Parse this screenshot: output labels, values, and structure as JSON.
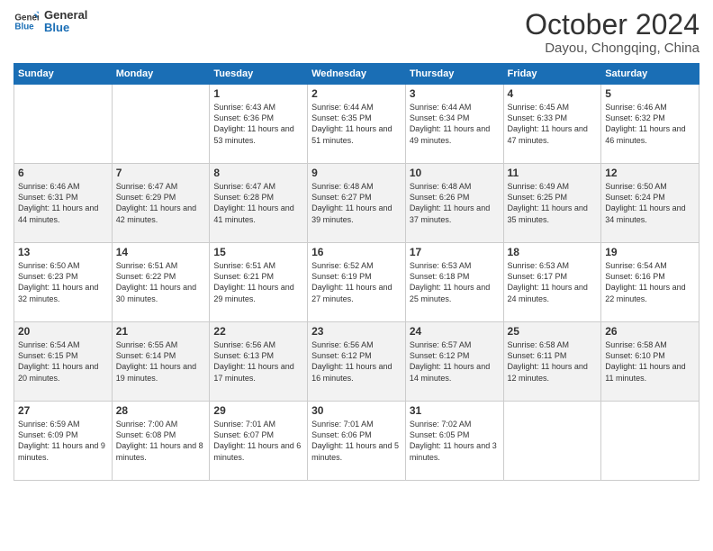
{
  "logo": {
    "line1": "General",
    "line2": "Blue"
  },
  "title": "October 2024",
  "location": "Dayou, Chongqing, China",
  "weekdays": [
    "Sunday",
    "Monday",
    "Tuesday",
    "Wednesday",
    "Thursday",
    "Friday",
    "Saturday"
  ],
  "weeks": [
    [
      {
        "day": "",
        "info": ""
      },
      {
        "day": "",
        "info": ""
      },
      {
        "day": "1",
        "info": "Sunrise: 6:43 AM\nSunset: 6:36 PM\nDaylight: 11 hours and 53 minutes."
      },
      {
        "day": "2",
        "info": "Sunrise: 6:44 AM\nSunset: 6:35 PM\nDaylight: 11 hours and 51 minutes."
      },
      {
        "day": "3",
        "info": "Sunrise: 6:44 AM\nSunset: 6:34 PM\nDaylight: 11 hours and 49 minutes."
      },
      {
        "day": "4",
        "info": "Sunrise: 6:45 AM\nSunset: 6:33 PM\nDaylight: 11 hours and 47 minutes."
      },
      {
        "day": "5",
        "info": "Sunrise: 6:46 AM\nSunset: 6:32 PM\nDaylight: 11 hours and 46 minutes."
      }
    ],
    [
      {
        "day": "6",
        "info": "Sunrise: 6:46 AM\nSunset: 6:31 PM\nDaylight: 11 hours and 44 minutes."
      },
      {
        "day": "7",
        "info": "Sunrise: 6:47 AM\nSunset: 6:29 PM\nDaylight: 11 hours and 42 minutes."
      },
      {
        "day": "8",
        "info": "Sunrise: 6:47 AM\nSunset: 6:28 PM\nDaylight: 11 hours and 41 minutes."
      },
      {
        "day": "9",
        "info": "Sunrise: 6:48 AM\nSunset: 6:27 PM\nDaylight: 11 hours and 39 minutes."
      },
      {
        "day": "10",
        "info": "Sunrise: 6:48 AM\nSunset: 6:26 PM\nDaylight: 11 hours and 37 minutes."
      },
      {
        "day": "11",
        "info": "Sunrise: 6:49 AM\nSunset: 6:25 PM\nDaylight: 11 hours and 35 minutes."
      },
      {
        "day": "12",
        "info": "Sunrise: 6:50 AM\nSunset: 6:24 PM\nDaylight: 11 hours and 34 minutes."
      }
    ],
    [
      {
        "day": "13",
        "info": "Sunrise: 6:50 AM\nSunset: 6:23 PM\nDaylight: 11 hours and 32 minutes."
      },
      {
        "day": "14",
        "info": "Sunrise: 6:51 AM\nSunset: 6:22 PM\nDaylight: 11 hours and 30 minutes."
      },
      {
        "day": "15",
        "info": "Sunrise: 6:51 AM\nSunset: 6:21 PM\nDaylight: 11 hours and 29 minutes."
      },
      {
        "day": "16",
        "info": "Sunrise: 6:52 AM\nSunset: 6:19 PM\nDaylight: 11 hours and 27 minutes."
      },
      {
        "day": "17",
        "info": "Sunrise: 6:53 AM\nSunset: 6:18 PM\nDaylight: 11 hours and 25 minutes."
      },
      {
        "day": "18",
        "info": "Sunrise: 6:53 AM\nSunset: 6:17 PM\nDaylight: 11 hours and 24 minutes."
      },
      {
        "day": "19",
        "info": "Sunrise: 6:54 AM\nSunset: 6:16 PM\nDaylight: 11 hours and 22 minutes."
      }
    ],
    [
      {
        "day": "20",
        "info": "Sunrise: 6:54 AM\nSunset: 6:15 PM\nDaylight: 11 hours and 20 minutes."
      },
      {
        "day": "21",
        "info": "Sunrise: 6:55 AM\nSunset: 6:14 PM\nDaylight: 11 hours and 19 minutes."
      },
      {
        "day": "22",
        "info": "Sunrise: 6:56 AM\nSunset: 6:13 PM\nDaylight: 11 hours and 17 minutes."
      },
      {
        "day": "23",
        "info": "Sunrise: 6:56 AM\nSunset: 6:12 PM\nDaylight: 11 hours and 16 minutes."
      },
      {
        "day": "24",
        "info": "Sunrise: 6:57 AM\nSunset: 6:12 PM\nDaylight: 11 hours and 14 minutes."
      },
      {
        "day": "25",
        "info": "Sunrise: 6:58 AM\nSunset: 6:11 PM\nDaylight: 11 hours and 12 minutes."
      },
      {
        "day": "26",
        "info": "Sunrise: 6:58 AM\nSunset: 6:10 PM\nDaylight: 11 hours and 11 minutes."
      }
    ],
    [
      {
        "day": "27",
        "info": "Sunrise: 6:59 AM\nSunset: 6:09 PM\nDaylight: 11 hours and 9 minutes."
      },
      {
        "day": "28",
        "info": "Sunrise: 7:00 AM\nSunset: 6:08 PM\nDaylight: 11 hours and 8 minutes."
      },
      {
        "day": "29",
        "info": "Sunrise: 7:01 AM\nSunset: 6:07 PM\nDaylight: 11 hours and 6 minutes."
      },
      {
        "day": "30",
        "info": "Sunrise: 7:01 AM\nSunset: 6:06 PM\nDaylight: 11 hours and 5 minutes."
      },
      {
        "day": "31",
        "info": "Sunrise: 7:02 AM\nSunset: 6:05 PM\nDaylight: 11 hours and 3 minutes."
      },
      {
        "day": "",
        "info": ""
      },
      {
        "day": "",
        "info": ""
      }
    ]
  ]
}
